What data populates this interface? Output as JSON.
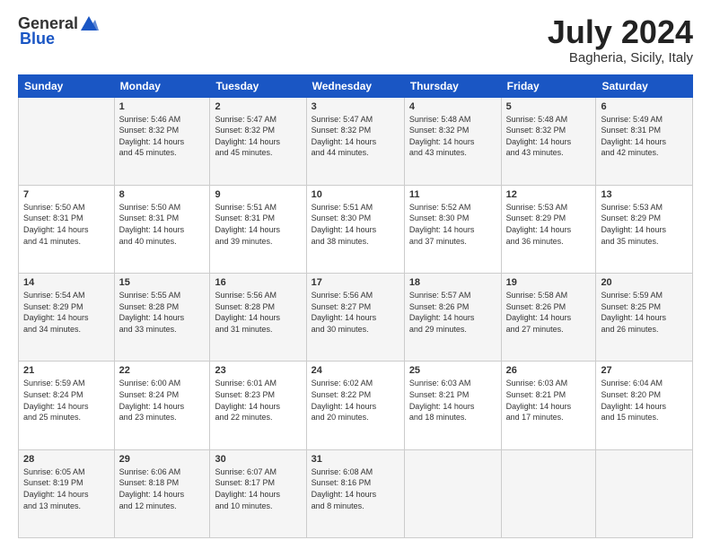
{
  "header": {
    "logo_general": "General",
    "logo_blue": "Blue",
    "month_title": "July 2024",
    "subtitle": "Bagheria, Sicily, Italy"
  },
  "days_of_week": [
    "Sunday",
    "Monday",
    "Tuesday",
    "Wednesday",
    "Thursday",
    "Friday",
    "Saturday"
  ],
  "weeks": [
    [
      {
        "day": "",
        "lines": []
      },
      {
        "day": "1",
        "lines": [
          "Sunrise: 5:46 AM",
          "Sunset: 8:32 PM",
          "Daylight: 14 hours",
          "and 45 minutes."
        ]
      },
      {
        "day": "2",
        "lines": [
          "Sunrise: 5:47 AM",
          "Sunset: 8:32 PM",
          "Daylight: 14 hours",
          "and 45 minutes."
        ]
      },
      {
        "day": "3",
        "lines": [
          "Sunrise: 5:47 AM",
          "Sunset: 8:32 PM",
          "Daylight: 14 hours",
          "and 44 minutes."
        ]
      },
      {
        "day": "4",
        "lines": [
          "Sunrise: 5:48 AM",
          "Sunset: 8:32 PM",
          "Daylight: 14 hours",
          "and 43 minutes."
        ]
      },
      {
        "day": "5",
        "lines": [
          "Sunrise: 5:48 AM",
          "Sunset: 8:32 PM",
          "Daylight: 14 hours",
          "and 43 minutes."
        ]
      },
      {
        "day": "6",
        "lines": [
          "Sunrise: 5:49 AM",
          "Sunset: 8:31 PM",
          "Daylight: 14 hours",
          "and 42 minutes."
        ]
      }
    ],
    [
      {
        "day": "7",
        "lines": [
          "Sunrise: 5:50 AM",
          "Sunset: 8:31 PM",
          "Daylight: 14 hours",
          "and 41 minutes."
        ]
      },
      {
        "day": "8",
        "lines": [
          "Sunrise: 5:50 AM",
          "Sunset: 8:31 PM",
          "Daylight: 14 hours",
          "and 40 minutes."
        ]
      },
      {
        "day": "9",
        "lines": [
          "Sunrise: 5:51 AM",
          "Sunset: 8:31 PM",
          "Daylight: 14 hours",
          "and 39 minutes."
        ]
      },
      {
        "day": "10",
        "lines": [
          "Sunrise: 5:51 AM",
          "Sunset: 8:30 PM",
          "Daylight: 14 hours",
          "and 38 minutes."
        ]
      },
      {
        "day": "11",
        "lines": [
          "Sunrise: 5:52 AM",
          "Sunset: 8:30 PM",
          "Daylight: 14 hours",
          "and 37 minutes."
        ]
      },
      {
        "day": "12",
        "lines": [
          "Sunrise: 5:53 AM",
          "Sunset: 8:29 PM",
          "Daylight: 14 hours",
          "and 36 minutes."
        ]
      },
      {
        "day": "13",
        "lines": [
          "Sunrise: 5:53 AM",
          "Sunset: 8:29 PM",
          "Daylight: 14 hours",
          "and 35 minutes."
        ]
      }
    ],
    [
      {
        "day": "14",
        "lines": [
          "Sunrise: 5:54 AM",
          "Sunset: 8:29 PM",
          "Daylight: 14 hours",
          "and 34 minutes."
        ]
      },
      {
        "day": "15",
        "lines": [
          "Sunrise: 5:55 AM",
          "Sunset: 8:28 PM",
          "Daylight: 14 hours",
          "and 33 minutes."
        ]
      },
      {
        "day": "16",
        "lines": [
          "Sunrise: 5:56 AM",
          "Sunset: 8:28 PM",
          "Daylight: 14 hours",
          "and 31 minutes."
        ]
      },
      {
        "day": "17",
        "lines": [
          "Sunrise: 5:56 AM",
          "Sunset: 8:27 PM",
          "Daylight: 14 hours",
          "and 30 minutes."
        ]
      },
      {
        "day": "18",
        "lines": [
          "Sunrise: 5:57 AM",
          "Sunset: 8:26 PM",
          "Daylight: 14 hours",
          "and 29 minutes."
        ]
      },
      {
        "day": "19",
        "lines": [
          "Sunrise: 5:58 AM",
          "Sunset: 8:26 PM",
          "Daylight: 14 hours",
          "and 27 minutes."
        ]
      },
      {
        "day": "20",
        "lines": [
          "Sunrise: 5:59 AM",
          "Sunset: 8:25 PM",
          "Daylight: 14 hours",
          "and 26 minutes."
        ]
      }
    ],
    [
      {
        "day": "21",
        "lines": [
          "Sunrise: 5:59 AM",
          "Sunset: 8:24 PM",
          "Daylight: 14 hours",
          "and 25 minutes."
        ]
      },
      {
        "day": "22",
        "lines": [
          "Sunrise: 6:00 AM",
          "Sunset: 8:24 PM",
          "Daylight: 14 hours",
          "and 23 minutes."
        ]
      },
      {
        "day": "23",
        "lines": [
          "Sunrise: 6:01 AM",
          "Sunset: 8:23 PM",
          "Daylight: 14 hours",
          "and 22 minutes."
        ]
      },
      {
        "day": "24",
        "lines": [
          "Sunrise: 6:02 AM",
          "Sunset: 8:22 PM",
          "Daylight: 14 hours",
          "and 20 minutes."
        ]
      },
      {
        "day": "25",
        "lines": [
          "Sunrise: 6:03 AM",
          "Sunset: 8:21 PM",
          "Daylight: 14 hours",
          "and 18 minutes."
        ]
      },
      {
        "day": "26",
        "lines": [
          "Sunrise: 6:03 AM",
          "Sunset: 8:21 PM",
          "Daylight: 14 hours",
          "and 17 minutes."
        ]
      },
      {
        "day": "27",
        "lines": [
          "Sunrise: 6:04 AM",
          "Sunset: 8:20 PM",
          "Daylight: 14 hours",
          "and 15 minutes."
        ]
      }
    ],
    [
      {
        "day": "28",
        "lines": [
          "Sunrise: 6:05 AM",
          "Sunset: 8:19 PM",
          "Daylight: 14 hours",
          "and 13 minutes."
        ]
      },
      {
        "day": "29",
        "lines": [
          "Sunrise: 6:06 AM",
          "Sunset: 8:18 PM",
          "Daylight: 14 hours",
          "and 12 minutes."
        ]
      },
      {
        "day": "30",
        "lines": [
          "Sunrise: 6:07 AM",
          "Sunset: 8:17 PM",
          "Daylight: 14 hours",
          "and 10 minutes."
        ]
      },
      {
        "day": "31",
        "lines": [
          "Sunrise: 6:08 AM",
          "Sunset: 8:16 PM",
          "Daylight: 14 hours",
          "and 8 minutes."
        ]
      },
      {
        "day": "",
        "lines": []
      },
      {
        "day": "",
        "lines": []
      },
      {
        "day": "",
        "lines": []
      }
    ]
  ]
}
